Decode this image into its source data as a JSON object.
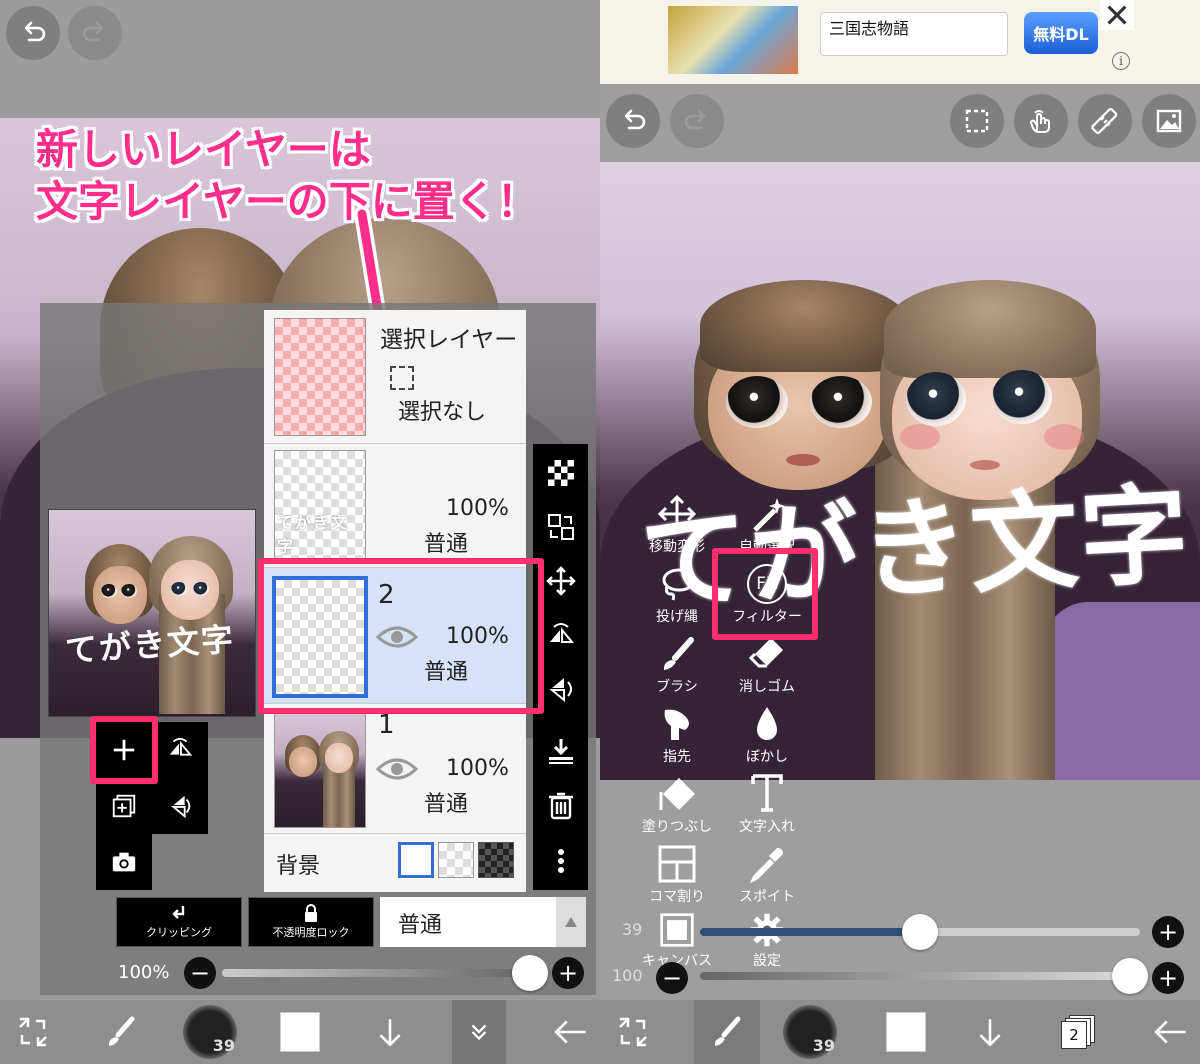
{
  "instruction": {
    "line1": "新しいレイヤーは",
    "line2": "文字レイヤーの下に置く！"
  },
  "canvas_text": "てがき文字",
  "layers": {
    "selection": {
      "title": "選択レイヤー",
      "status": "選択なし"
    },
    "text_layer": {
      "opacity": "100%",
      "blend": "普通"
    },
    "layer2": {
      "number": "2",
      "opacity": "100%",
      "blend": "普通"
    },
    "layer1": {
      "number": "1",
      "opacity": "100%",
      "blend": "普通"
    },
    "background_label": "背景"
  },
  "layer_controls": {
    "clipping": "クリッピング",
    "opacity_lock": "不透明度ロック",
    "blend_mode": "普通",
    "opacity_value": "100%"
  },
  "left_bottom": {
    "brush_size": "39"
  },
  "ad": {
    "title": "三国志物語",
    "button": "無料DL"
  },
  "tool_menu": {
    "items": [
      {
        "label": "移動変形",
        "icon": "move-transform-icon"
      },
      {
        "label": "自動選択",
        "icon": "magic-wand-icon"
      },
      {
        "label": "投げ縄",
        "icon": "lasso-icon"
      },
      {
        "label": "フィルター",
        "icon": "fx-filter-icon"
      },
      {
        "label": "ブラシ",
        "icon": "brush-icon"
      },
      {
        "label": "消しゴム",
        "icon": "eraser-icon"
      },
      {
        "label": "指先",
        "icon": "finger-smudge-icon"
      },
      {
        "label": "ぼかし",
        "icon": "blur-drop-icon"
      },
      {
        "label": "塗りつぶし",
        "icon": "fill-bucket-icon"
      },
      {
        "label": "文字入れ",
        "icon": "text-tool-icon"
      },
      {
        "label": "コマ割り",
        "icon": "frame-divider-icon"
      },
      {
        "label": "スポイト",
        "icon": "eyedropper-icon"
      },
      {
        "label": "キャンバス",
        "icon": "canvas-icon"
      },
      {
        "label": "設定",
        "icon": "settings-gear-icon"
      }
    ],
    "fx_symbol": "FX"
  },
  "right_sliders": {
    "size_value": "39",
    "opacity_value": "100"
  },
  "right_bottom": {
    "brush_size": "39",
    "layer_count": "2"
  },
  "colors": {
    "highlight": "#ff2e6e",
    "instruction_text": "#ff2e8a",
    "selected_layer": "#d6e2f8",
    "accent_blue": "#2f6fd6"
  }
}
